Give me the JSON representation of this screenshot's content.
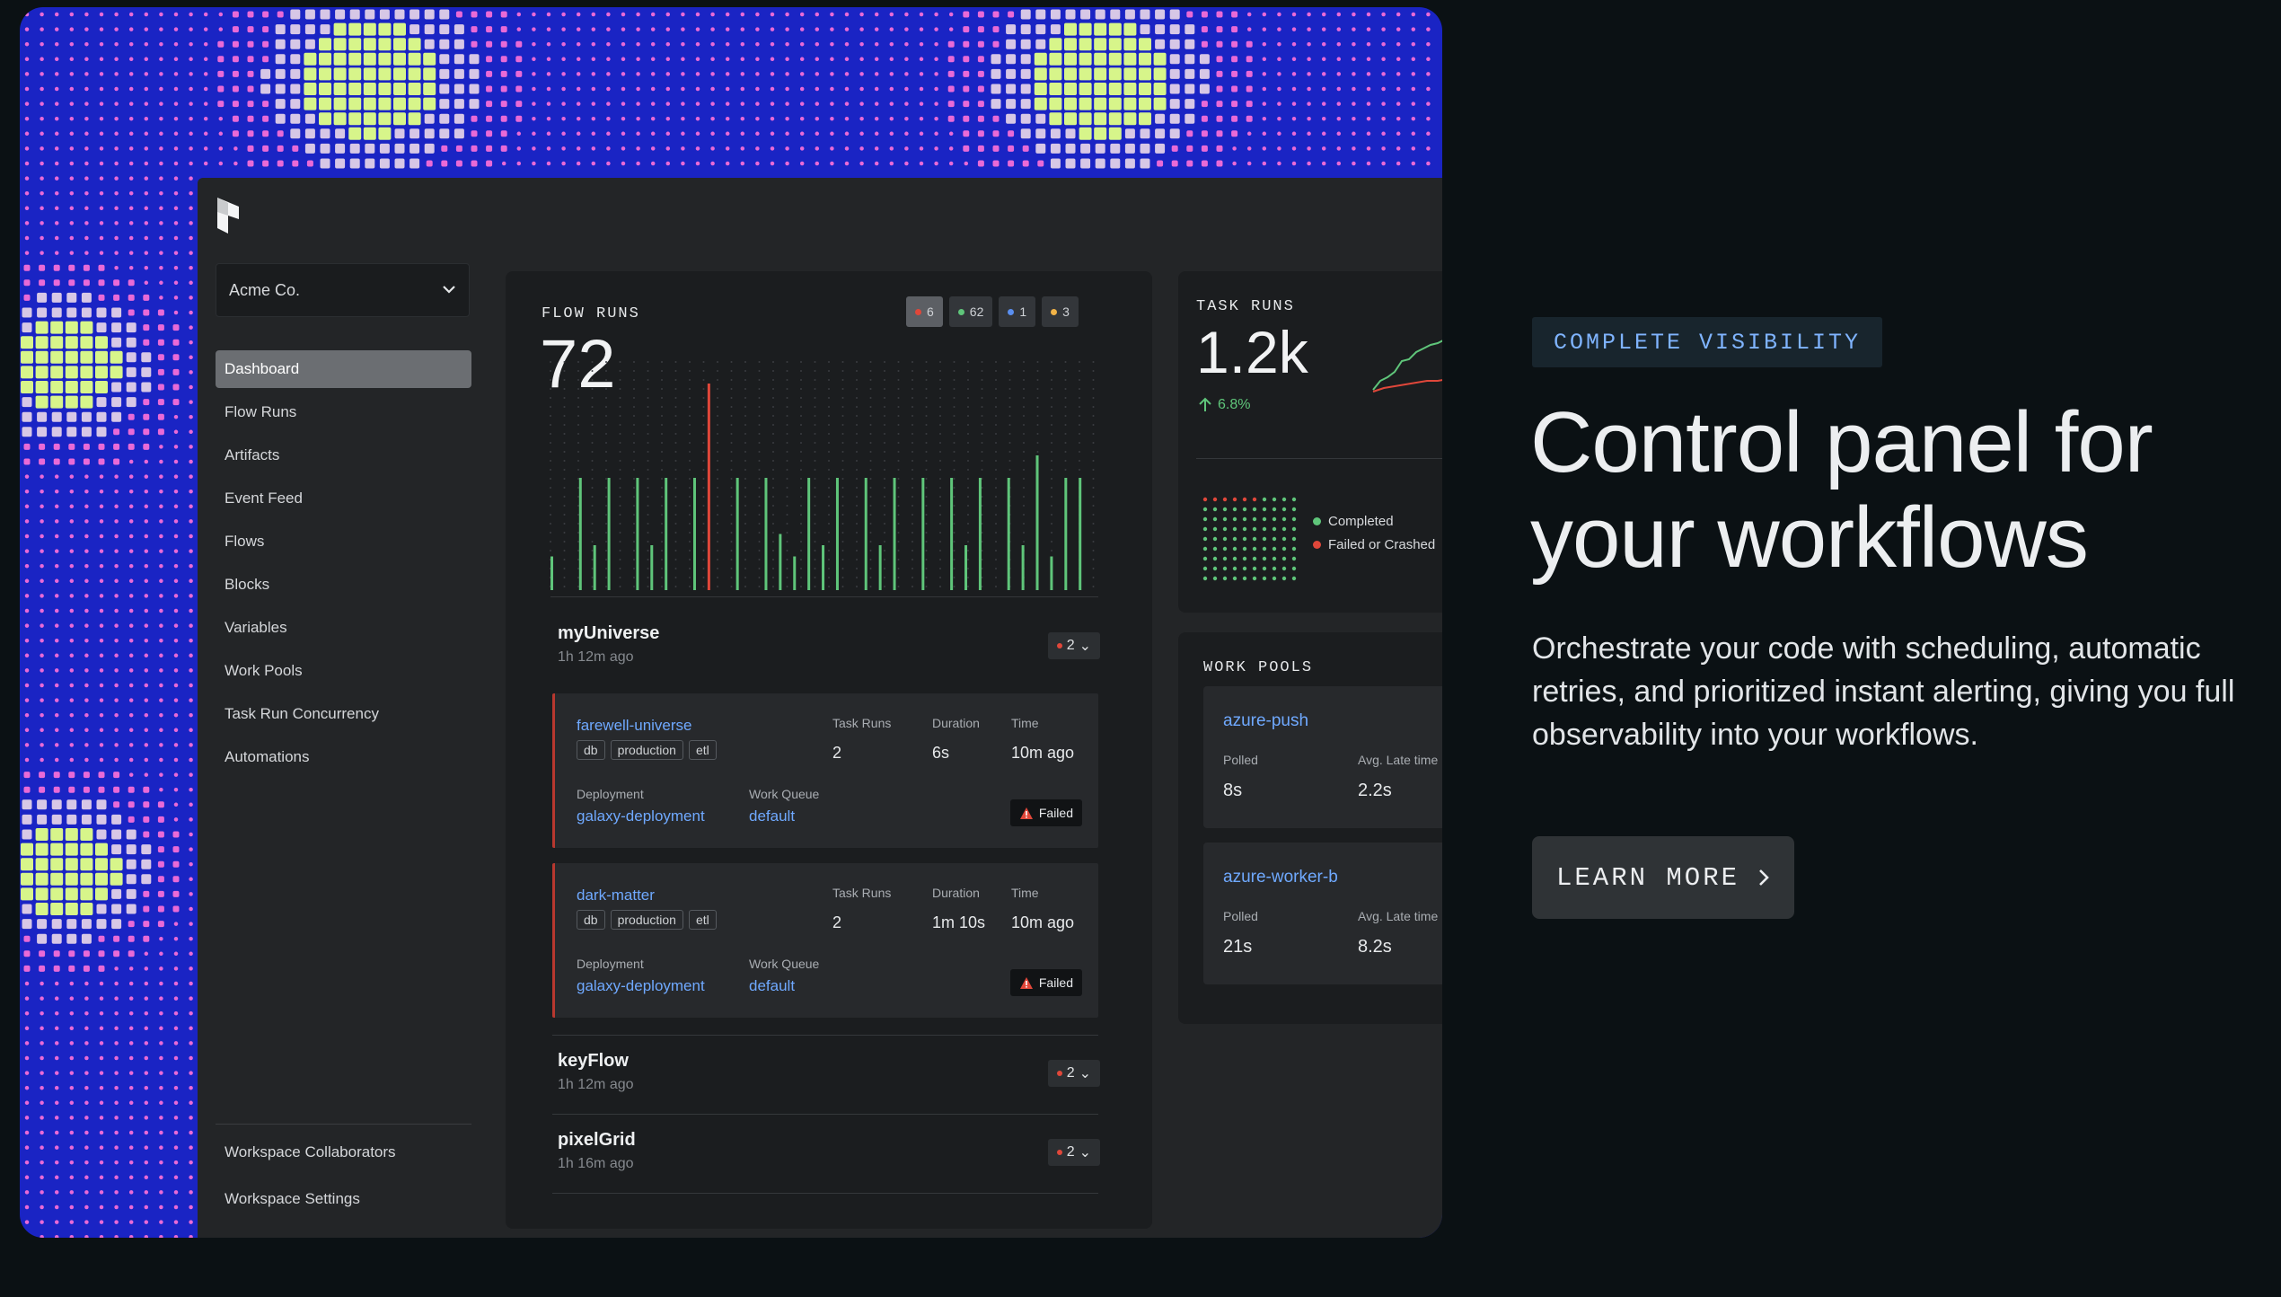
{
  "workspace": {
    "name": "Acme Co."
  },
  "nav": {
    "items": [
      "Dashboard",
      "Flow Runs",
      "Artifacts",
      "Event Feed",
      "Flows",
      "Blocks",
      "Variables",
      "Work Pools",
      "Task Run Concurrency",
      "Automations"
    ],
    "bottom": [
      "Workspace Collaborators",
      "Workspace Settings"
    ]
  },
  "flow_runs": {
    "title": "FLOW RUNS",
    "count": "72",
    "badges": [
      {
        "value": "6",
        "color": "#e0473a"
      },
      {
        "value": "62",
        "color": "#5fc57a"
      },
      {
        "value": "1",
        "color": "#5a8ff0"
      },
      {
        "value": "3",
        "color": "#f1b347"
      }
    ]
  },
  "chart_data": {
    "type": "bar",
    "series": [
      {
        "color": "#5fc57a",
        "values": [
          0.15,
          0,
          0.5,
          0.2,
          0.5,
          0,
          0.5,
          0.2,
          0.5,
          0,
          0.5,
          0,
          0,
          0.5,
          0,
          0.5,
          0.25,
          0.15,
          0.5,
          0.2,
          0.5,
          0,
          0.5,
          0.2,
          0.5,
          0,
          0.5,
          0,
          0.5,
          0.2,
          0.5,
          0,
          0.5,
          0.2,
          0.6,
          0.15,
          0.5,
          0.5
        ]
      },
      {
        "color": "#e0473a",
        "values": [
          0,
          0,
          0,
          0,
          0,
          0,
          0,
          0,
          0,
          0,
          0,
          0.92,
          0,
          0,
          0,
          0,
          0,
          0,
          0,
          0,
          0,
          0,
          0,
          0,
          0,
          0,
          0,
          0,
          0,
          0,
          0,
          0,
          0,
          0,
          0,
          0,
          0,
          0,
          0,
          0
        ]
      }
    ]
  },
  "groups": [
    {
      "name": "myUniverse",
      "time": "1h 12m ago",
      "count": "2"
    },
    {
      "name": "keyFlow",
      "time": "1h 12m ago",
      "count": "2"
    },
    {
      "name": "pixelGrid",
      "time": "1h 16m ago",
      "count": "2"
    }
  ],
  "runs": [
    {
      "name": "farewell-universe",
      "tags": [
        "db",
        "production",
        "etl"
      ],
      "task_runs": "2",
      "duration": "6s",
      "time": "10m ago",
      "deployment": "galaxy-deployment",
      "work_queue": "default",
      "state": "Failed"
    },
    {
      "name": "dark-matter",
      "tags": [
        "db",
        "production",
        "etl"
      ],
      "task_runs": "2",
      "duration": "1m 10s",
      "time": "10m ago",
      "deployment": "galaxy-deployment",
      "work_queue": "default",
      "state": "Failed"
    }
  ],
  "labels": {
    "task_runs": "Task Runs",
    "duration": "Duration",
    "time": "Time",
    "deployment": "Deployment",
    "work_queue": "Work Queue",
    "polled": "Polled",
    "avg_late": "Avg. Late time"
  },
  "task_runs": {
    "title": "TASK RUNS",
    "count": "1.2k",
    "delta": "6.8%",
    "legend": [
      "Completed",
      "Failed or Crashed"
    ]
  },
  "work_pools": {
    "title": "WORK POOLS",
    "pools": [
      {
        "name": "azure-push",
        "polled": "8s",
        "late": "2.2s"
      },
      {
        "name": "azure-worker-b",
        "polled": "21s",
        "late": "8.2s"
      }
    ]
  },
  "hero": {
    "eyebrow": "COMPLETE VISIBILITY",
    "headline_1": "Control panel for",
    "headline_2": "your workflows",
    "subcopy": "Orchestrate your code with scheduling, automatic retries, and prioritized instant alerting, giving you full observability into your workflows.",
    "cta": "LEARN MORE"
  },
  "colors": {
    "brand_blue": "#1a24c4",
    "accent_green": "#d7f58a",
    "pink": "#e96ad7",
    "link": "#6fa9ff",
    "failed": "#e0473a",
    "completed": "#5fc57a"
  }
}
